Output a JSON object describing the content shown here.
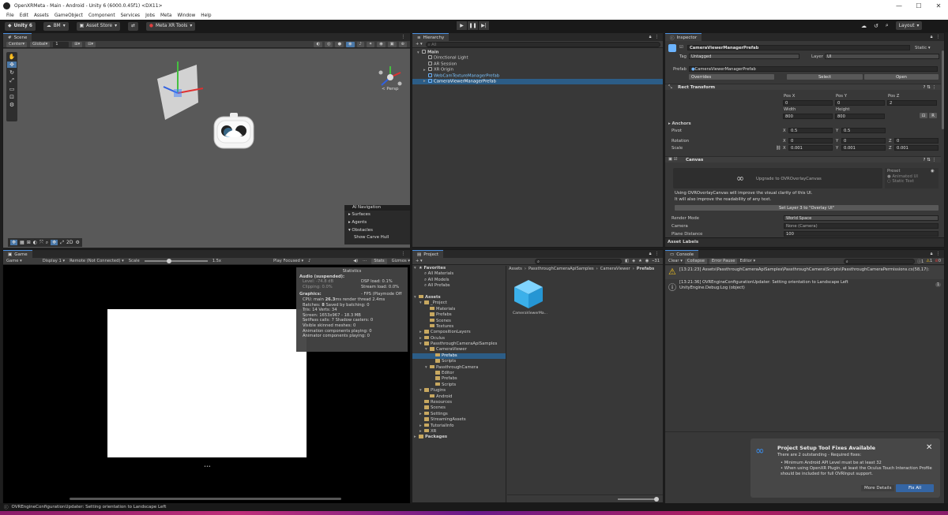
{
  "window": {
    "title": "OpenXRMeta - Main - Android - Unity 6 (6000.0.45f1) <DX11>",
    "min": "—",
    "max": "☐",
    "close": "✕"
  },
  "menu": [
    "File",
    "Edit",
    "Assets",
    "GameObject",
    "Component",
    "Services",
    "Jobs",
    "Meta",
    "Window",
    "Help"
  ],
  "toolbar": {
    "unity": "Unity 6",
    "account": "BM",
    "asset_store": "Asset Store",
    "meta_tools": "Meta XR Tools",
    "layout": "Layout"
  },
  "scene": {
    "tab": "Scene",
    "pivot": "Center",
    "space": "Global",
    "grid": "1",
    "persp": "< Persp",
    "ai_nav": {
      "title": "AI Navigation",
      "items": [
        "Surfaces",
        "Agents",
        "Obstacles"
      ],
      "carve": "Show Carve Hull"
    },
    "bottom_mode": "2D"
  },
  "game": {
    "tab": "Game",
    "mode": "Game",
    "display": "Display 1",
    "remote": "Remote (Not Connected)",
    "scale_label": "Scale",
    "scale_value": "1.5x",
    "play_focused": "Play Focused",
    "stats": "Stats",
    "gizmos": "Gizmos",
    "ellipsis": "•••",
    "statistics": {
      "title": "Statistics",
      "audio_header": "Audio (suspended):",
      "level": "Level: -74.8 dB",
      "clipping": "Clipping: 0.0%",
      "dsp": "DSP load: 0.1%",
      "stream": "Stream load: 0.0%",
      "graphics_header": "Graphics:",
      "fps": "- FPS (Playmode Off",
      "cpu_pre": "CPU: main ",
      "cpu_main": "26.3",
      "cpu_post": "ms  render thread 2.4ms",
      "batches_pre": "Batches: ",
      "batches_val": "8",
      "batches_post": "   Saved by batching: 0",
      "tris": "Tris: 14    Verts: 34",
      "screen": "Screen: 1653x967 - 18.3 MB",
      "setpass": "SetPass calls: 7  Shadow casters: 0",
      "skinned": "Visible skinned meshes: 0",
      "anim": "Animation components playing: 0",
      "animator": "Animator components playing: 0"
    }
  },
  "hierarchy": {
    "tab": "Hierarchy",
    "search_placeholder": "All",
    "items": [
      {
        "label": "Main",
        "depth": 0,
        "fold": "▾",
        "kind": "scene"
      },
      {
        "label": "Directional Light",
        "depth": 1,
        "fold": "",
        "kind": "go"
      },
      {
        "label": "AR Session",
        "depth": 1,
        "fold": "",
        "kind": "go"
      },
      {
        "label": "XR Origin",
        "depth": 1,
        "fold": "▸",
        "kind": "go"
      },
      {
        "label": "WebCamTextureManagerPrefab",
        "depth": 1,
        "fold": "",
        "kind": "prefab"
      },
      {
        "label": "CameraViewerManagerPrefab",
        "depth": 1,
        "fold": "▸",
        "kind": "prefab",
        "selected": true
      }
    ]
  },
  "project": {
    "tab": "Project",
    "count": "31",
    "tree": [
      {
        "label": "Favorites",
        "depth": 0,
        "fold": "▾",
        "icon": "star"
      },
      {
        "label": "All Materials",
        "depth": 1,
        "fold": "",
        "icon": "search"
      },
      {
        "label": "All Models",
        "depth": 1,
        "fold": "",
        "icon": "search"
      },
      {
        "label": "All Prefabs",
        "depth": 1,
        "fold": "",
        "icon": "search"
      },
      {
        "label": "",
        "depth": 0,
        "fold": "",
        "icon": "none"
      },
      {
        "label": "Assets",
        "depth": 0,
        "fold": "▾",
        "icon": "folder"
      },
      {
        "label": "_Project",
        "depth": 1,
        "fold": "▾",
        "icon": "folder"
      },
      {
        "label": "Materials",
        "depth": 2,
        "fold": "",
        "icon": "folder"
      },
      {
        "label": "Prefabs",
        "depth": 2,
        "fold": "",
        "icon": "folder"
      },
      {
        "label": "Scenes",
        "depth": 2,
        "fold": "",
        "icon": "folder"
      },
      {
        "label": "Textures",
        "depth": 2,
        "fold": "",
        "icon": "folder"
      },
      {
        "label": "CompositionLayers",
        "depth": 1,
        "fold": "▸",
        "icon": "folder"
      },
      {
        "label": "Oculus",
        "depth": 1,
        "fold": "▸",
        "icon": "folder"
      },
      {
        "label": "PassthroughCameraApiSamples",
        "depth": 1,
        "fold": "▾",
        "icon": "folder"
      },
      {
        "label": "CameraViewer",
        "depth": 2,
        "fold": "▾",
        "icon": "folder"
      },
      {
        "label": "Prefabs",
        "depth": 3,
        "fold": "",
        "icon": "folder",
        "selected": true
      },
      {
        "label": "Scripts",
        "depth": 3,
        "fold": "",
        "icon": "folder"
      },
      {
        "label": "PassthroughCamera",
        "depth": 2,
        "fold": "▾",
        "icon": "folder"
      },
      {
        "label": "Editor",
        "depth": 3,
        "fold": "",
        "icon": "folder"
      },
      {
        "label": "Prefabs",
        "depth": 3,
        "fold": "",
        "icon": "folder"
      },
      {
        "label": "Scripts",
        "depth": 3,
        "fold": "",
        "icon": "folder"
      },
      {
        "label": "Plugins",
        "depth": 1,
        "fold": "▾",
        "icon": "folder"
      },
      {
        "label": "Android",
        "depth": 2,
        "fold": "",
        "icon": "folder"
      },
      {
        "label": "Resources",
        "depth": 1,
        "fold": "",
        "icon": "folder"
      },
      {
        "label": "Scenes",
        "depth": 1,
        "fold": "",
        "icon": "folder"
      },
      {
        "label": "Settings",
        "depth": 1,
        "fold": "▸",
        "icon": "folder"
      },
      {
        "label": "StreamingAssets",
        "depth": 1,
        "fold": "",
        "icon": "folder"
      },
      {
        "label": "TutorialInfo",
        "depth": 1,
        "fold": "▸",
        "icon": "folder"
      },
      {
        "label": "XR",
        "depth": 1,
        "fold": "▸",
        "icon": "folder"
      },
      {
        "label": "Packages",
        "depth": 0,
        "fold": "▸",
        "icon": "folder"
      }
    ],
    "breadcrumb": [
      "Assets",
      "PassthroughCameraApiSamples",
      "CameraViewer",
      "Prefabs"
    ],
    "asset_name": "CameraViewerMa..."
  },
  "inspector": {
    "tab": "Inspector",
    "object_name": "CameraViewerManagerPrefab",
    "static_label": "Static",
    "tag_label": "Tag",
    "tag_value": "Untagged",
    "layer_label": "Layer",
    "layer_value": "UI",
    "prefab_label": "Prefab",
    "prefab_value": "CameraViewerManagerPrefab",
    "overrides": "Overrides",
    "select": "Select",
    "open": "Open",
    "rect_transform": {
      "title": "Rect Transform",
      "pos_x_label": "Pos X",
      "pos_y_label": "Pos Y",
      "pos_z_label": "Pos Z",
      "pos_x": "0",
      "pos_y": "0",
      "pos_z": "2",
      "width_label": "Width",
      "height_label": "Height",
      "width": "800",
      "height": "800",
      "anchors": "Anchors",
      "pivot_label": "Pivot",
      "pivot_x": "0.5",
      "pivot_y": "0.5",
      "rotation_label": "Rotation",
      "rot_x": "0",
      "rot_y": "0",
      "rot_z": "0",
      "scale_label": "Scale",
      "scale_x": "0.001",
      "scale_y": "0.001",
      "scale_z": "0.001"
    },
    "canvas": {
      "title": "Canvas",
      "upgrade": "Upgrade to OVROverlayCanvas",
      "preset": "Preset",
      "preset_animated": "Animated UI",
      "preset_static": "Static Text",
      "info1": "Using OVROverlayCanvas will improve the visual clarity of this UI.",
      "info2": "It will also improve the readability of any text.",
      "set_layer": "Set Layer 3 to \"Overlay UI\"",
      "render_mode_label": "Render Mode",
      "render_mode": "World Space",
      "camera_label": "Camera",
      "camera": "None (Camera)",
      "plane_label": "Plane Distance",
      "plane": "100"
    },
    "asset_labels": "Asset Labels"
  },
  "console": {
    "tab": "Console",
    "clear": "Clear",
    "collapse": "Collapse",
    "error_pause": "Error Pause",
    "editor": "Editor",
    "count_info": "1",
    "count_warn": "1",
    "count_err": "0",
    "entries": [
      {
        "type": "warning",
        "line1": "[13:21:23] Assets\\PassthroughCameraApiSamples\\PassthroughCamera\\Scripts\\PassthroughCameraPermissions.cs(58,17):",
        "line2": "",
        "count": ""
      },
      {
        "type": "info",
        "line1": "[13:21:36] OVREngineConfigurationUpdater: Setting orientation to Landscape Left",
        "line2": "UnityEngine.Debug:Log (object)",
        "count": "1"
      }
    ]
  },
  "notice": {
    "title": "Project Setup Tool Fixes Available",
    "subtitle": "There are 2 outstanding - Required fixes:",
    "bullet1": "• Minimum Android API Level must be at least 32",
    "bullet2": "• When using OpenXR Plugin, at least the Oculus Touch Interaction Profile should be included for full OVRInput support.",
    "more": "More Details",
    "fix": "Fix All",
    "close": "✕"
  },
  "statusbar": "OVREngineConfigurationUpdater: Setting orientation to Landscape Left",
  "colors": {
    "selected": "#2c5d87",
    "prefab_text": "#7cc4ff",
    "accent": "#4a90e2",
    "warn": "#f0c020"
  }
}
